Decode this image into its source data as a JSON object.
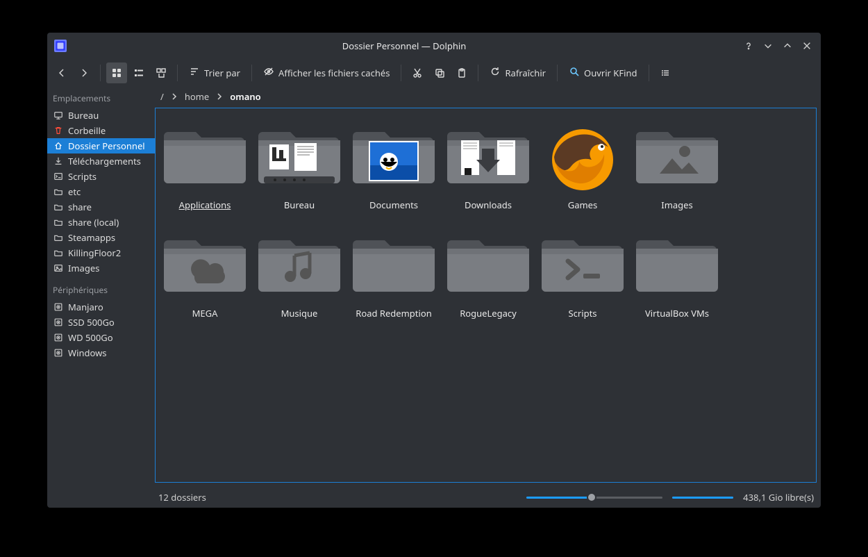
{
  "window": {
    "title": "Dossier Personnel — Dolphin"
  },
  "toolbar": {
    "sort_label": "Trier par",
    "show_hidden_label": "Afficher les fichiers cachés",
    "refresh_label": "Rafraîchir",
    "kfind_label": "Ouvrir KFind"
  },
  "breadcrumb": {
    "root": "/",
    "segments": [
      "home",
      "omano"
    ]
  },
  "sidebar": {
    "places_header": "Emplacements",
    "devices_header": "Périphériques",
    "places": [
      {
        "label": "Bureau",
        "icon": "desktop"
      },
      {
        "label": "Corbeille",
        "icon": "trash"
      },
      {
        "label": "Dossier Personnel",
        "icon": "home",
        "selected": true
      },
      {
        "label": "Téléchargements",
        "icon": "download"
      },
      {
        "label": "Scripts",
        "icon": "terminal"
      },
      {
        "label": "etc",
        "icon": "folder"
      },
      {
        "label": "share",
        "icon": "folder"
      },
      {
        "label": "share (local)",
        "icon": "folder"
      },
      {
        "label": "Steamapps",
        "icon": "folder"
      },
      {
        "label": "KillingFloor2",
        "icon": "folder"
      },
      {
        "label": "Images",
        "icon": "images"
      }
    ],
    "devices": [
      {
        "label": "Manjaro",
        "icon": "disk"
      },
      {
        "label": "SSD 500Go",
        "icon": "disk"
      },
      {
        "label": "WD 500Go",
        "icon": "disk"
      },
      {
        "label": "Windows",
        "icon": "disk"
      }
    ]
  },
  "items": [
    {
      "label": "Applications",
      "icon": "folder",
      "selected": true
    },
    {
      "label": "Bureau",
      "icon": "folder-desktop"
    },
    {
      "label": "Documents",
      "icon": "folder-docs"
    },
    {
      "label": "Downloads",
      "icon": "folder-dl"
    },
    {
      "label": "Games",
      "icon": "lutris"
    },
    {
      "label": "Images",
      "icon": "folder-img"
    },
    {
      "label": "MEGA",
      "icon": "folder-cloud"
    },
    {
      "label": "Musique",
      "icon": "folder-music"
    },
    {
      "label": "Road Redemption",
      "icon": "folder"
    },
    {
      "label": "RogueLegacy",
      "icon": "folder"
    },
    {
      "label": "Scripts",
      "icon": "folder-term"
    },
    {
      "label": "VirtualBox VMs",
      "icon": "folder"
    }
  ],
  "status": {
    "count_text": "12 dossiers",
    "zoom_pct": 48,
    "disk_fill_pct": 100,
    "free_text": "438,1 Gio libre(s)"
  }
}
